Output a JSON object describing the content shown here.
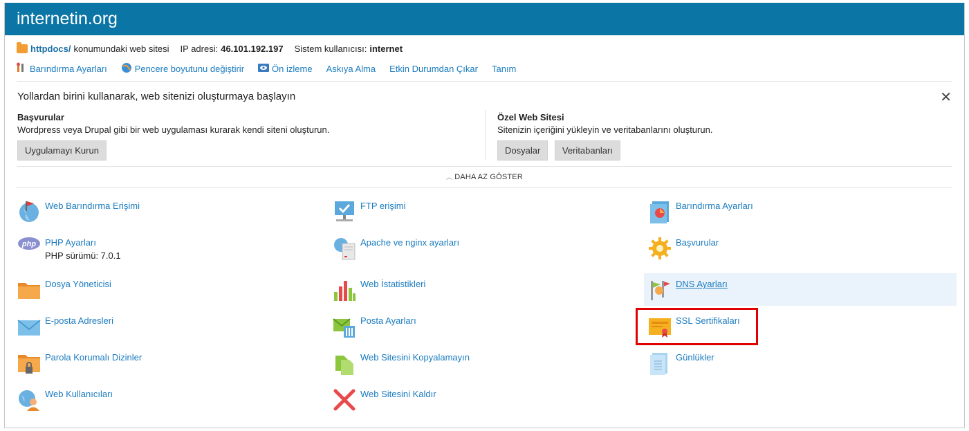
{
  "header": {
    "title": "internetin.org"
  },
  "info": {
    "folder_link": "httpdocs/",
    "folder_suffix": "konumundaki web sitesi",
    "ip_label": "IP adresi:",
    "ip_value": "46.101.192.197",
    "user_label": "Sistem kullanıcısı:",
    "user_value": "internet"
  },
  "actions": [
    {
      "label": "Barındırma Ayarları",
      "icon": "tools-icon"
    },
    {
      "label": "Pencere boyutunu değiştirir",
      "icon": "globe-icon"
    },
    {
      "label": "Ön izleme",
      "icon": "preview-icon"
    },
    {
      "label": "Askıya Alma"
    },
    {
      "label": "Etkin Durumdan Çıkar"
    },
    {
      "label": "Tanım"
    }
  ],
  "intro": {
    "title": "Yollardan birini kullanarak, web sitenizi oluşturmaya başlayın",
    "left": {
      "heading": "Başvurular",
      "text": "Wordpress veya Drupal gibi bir web uygulaması kurarak kendi siteni oluşturun.",
      "button": "Uygulamayı Kurun"
    },
    "right": {
      "heading": "Özel Web Sitesi",
      "text": "Sitenizin içeriğini yükleyin ve veritabanlarını oluşturun.",
      "buttons": [
        "Dosyalar",
        "Veritabanları"
      ]
    },
    "show_less": "DAHA AZ GÖSTER"
  },
  "tiles": {
    "col1": [
      {
        "label": "Web Barındırma Erişimi",
        "icon": "globe-flag-icon"
      },
      {
        "label": "PHP Ayarları",
        "sub": "PHP sürümü: 7.0.1",
        "icon": "php-icon"
      },
      {
        "label": "Dosya Yöneticisi",
        "icon": "folder-icon"
      },
      {
        "label": "E-posta Adresleri",
        "icon": "envelope-icon"
      },
      {
        "label": "Parola Korumalı Dizinler",
        "icon": "locked-folder-icon"
      },
      {
        "label": "Web Kullanıcıları",
        "icon": "web-user-icon"
      }
    ],
    "col2": [
      {
        "label": "FTP erişimi",
        "icon": "ftp-icon"
      },
      {
        "label": "Apache ve nginx ayarları",
        "icon": "server-icon"
      },
      {
        "label": "Web İstatistikleri",
        "icon": "bar-chart-icon"
      },
      {
        "label": "Posta Ayarları",
        "icon": "mail-settings-icon"
      },
      {
        "label": "Web Sitesini Kopyalamayın",
        "icon": "copy-icon"
      },
      {
        "label": "Web Sitesini Kaldır",
        "icon": "remove-icon"
      }
    ],
    "col3": [
      {
        "label": "Barındırma Ayarları",
        "icon": "hosting-settings-icon"
      },
      {
        "label": "Başvurular",
        "icon": "gear-icon"
      },
      {
        "label": "DNS Ayarları",
        "icon": "dns-icon"
      },
      {
        "label": "SSL Sertifikaları",
        "icon": "certificate-icon"
      },
      {
        "label": "Günlükler",
        "icon": "log-icon"
      }
    ]
  },
  "colors": {
    "header_bg": "#0b76a5",
    "link": "#1a7bbf",
    "highlight_box": "#e00000"
  }
}
